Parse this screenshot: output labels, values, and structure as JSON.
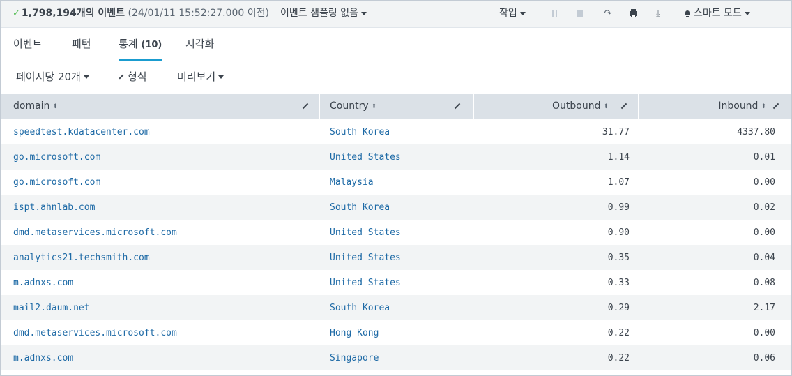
{
  "status": {
    "event_count": "1,798,194개의 이벤트",
    "event_time": "(24/01/11 15:52:27.000 이전)",
    "sampling": "이벤트 샘플링 없음",
    "job": "작업",
    "mode": "스마트 모드"
  },
  "tabs": {
    "events": "이벤트",
    "patterns": "패턴",
    "statistics": "통계",
    "statistics_count": "(10)",
    "visualization": "시각화"
  },
  "toolbar": {
    "per_page": "페이지당 20개",
    "format": "형식",
    "preview": "미리보기"
  },
  "table": {
    "headers": [
      "domain",
      "Country",
      "Outbound",
      "Inbound"
    ],
    "rows": [
      [
        "speedtest.kdatacenter.com",
        "South Korea",
        "31.77",
        "4337.80"
      ],
      [
        "go.microsoft.com",
        "United States",
        "1.14",
        "0.01"
      ],
      [
        "go.microsoft.com",
        "Malaysia",
        "1.07",
        "0.00"
      ],
      [
        "ispt.ahnlab.com",
        "South Korea",
        "0.99",
        "0.02"
      ],
      [
        "dmd.metaservices.microsoft.com",
        "United States",
        "0.90",
        "0.00"
      ],
      [
        "analytics21.techsmith.com",
        "United States",
        "0.35",
        "0.04"
      ],
      [
        "m.adnxs.com",
        "United States",
        "0.33",
        "0.08"
      ],
      [
        "mail2.daum.net",
        "South Korea",
        "0.29",
        "2.17"
      ],
      [
        "dmd.metaservices.microsoft.com",
        "Hong Kong",
        "0.22",
        "0.00"
      ],
      [
        "m.adnxs.com",
        "Singapore",
        "0.22",
        "0.06"
      ]
    ]
  }
}
